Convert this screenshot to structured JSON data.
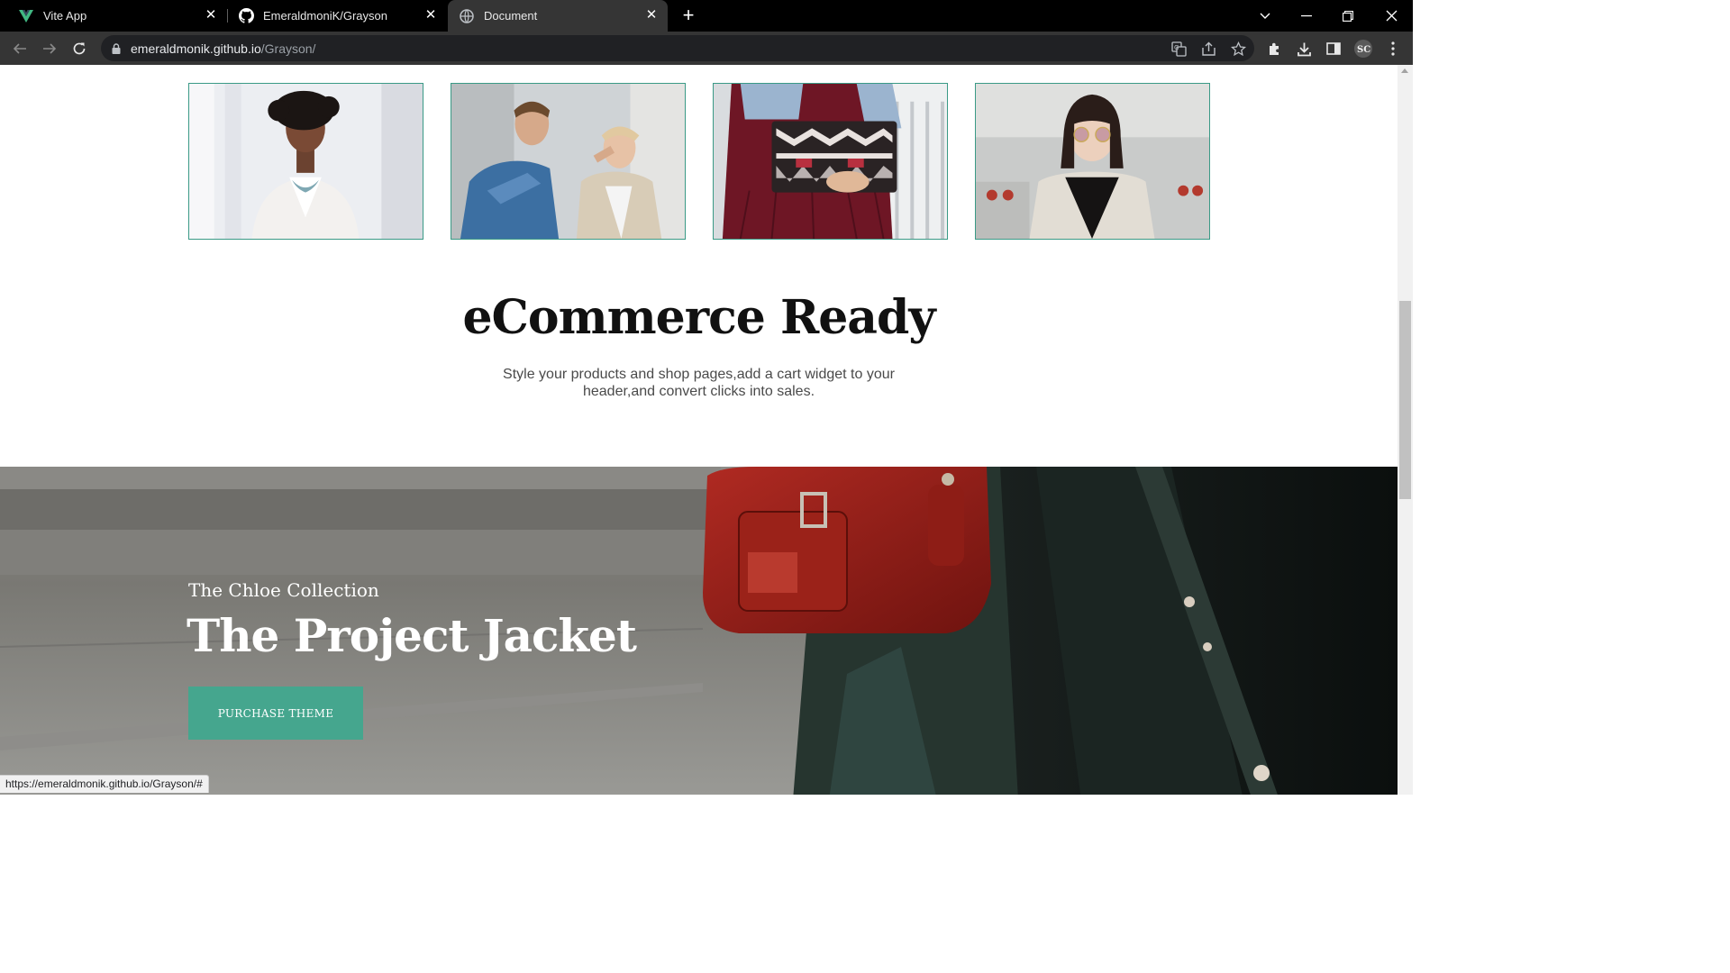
{
  "browser": {
    "tabs": [
      {
        "title": "Vite App",
        "icon": "vite-icon",
        "active": false
      },
      {
        "title": "EmeraldmoniK/Grayson",
        "icon": "github-icon",
        "active": false
      },
      {
        "title": "Document",
        "icon": "globe-icon",
        "active": true
      }
    ],
    "new_tab_label": "+",
    "address": {
      "host": "emeraldmonik.github.io",
      "path": "/Grayson/"
    },
    "status_url": "https://emeraldmonik.github.io/Grayson/#"
  },
  "page": {
    "gallery": [
      {
        "alt": "woman-white-blazer-image"
      },
      {
        "alt": "two-men-jackets-image"
      },
      {
        "alt": "red-skirt-clutch-image"
      },
      {
        "alt": "woman-sunglasses-image"
      }
    ],
    "section": {
      "title": "eCommerce Ready",
      "text": "Style your products and shop pages,add a cart widget to your header,and convert clicks into sales."
    },
    "hero": {
      "eyebrow": "The Chloe Collection",
      "headline": "The Project Jacket",
      "cta_label": "PURCHASE THEME"
    }
  },
  "colors": {
    "accent": "#45a68e",
    "card_border": "#3a9a86",
    "tab_active": "#353535",
    "tabstrip": "#000000"
  }
}
